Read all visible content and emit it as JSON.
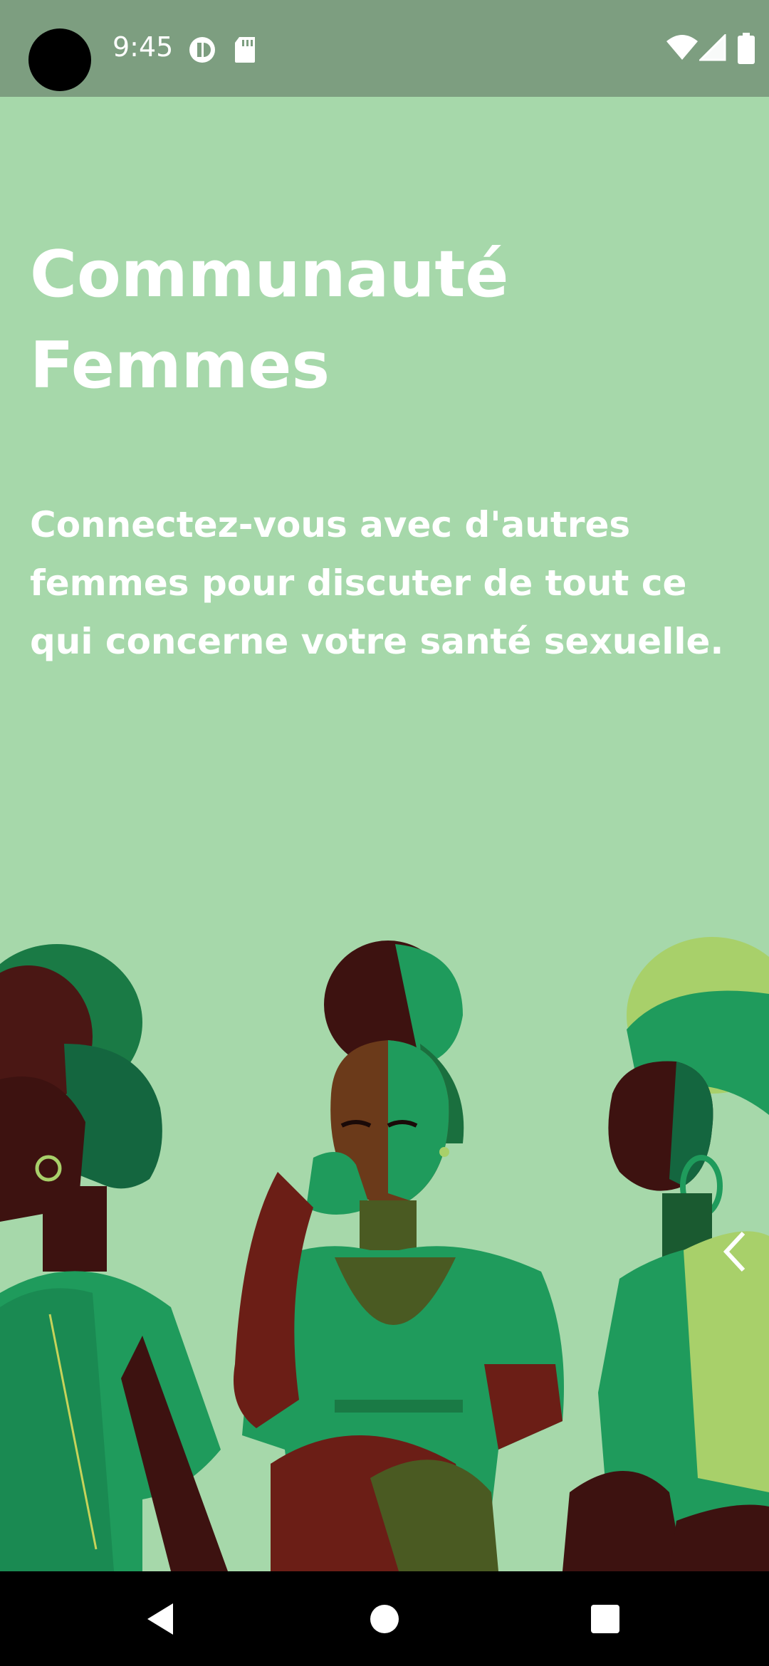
{
  "status_bar": {
    "time": "9:45",
    "icons": [
      "camera-cutout",
      "data-saver-icon",
      "sd-card-icon",
      "wifi-icon",
      "signal-icon",
      "battery-icon"
    ]
  },
  "onboarding": {
    "title": "Communauté Femmes",
    "subtitle": "Connectez-vous avec d'autres femmes pour discuter de tout ce qui concerne votre santé sexuelle.",
    "illustration": "three-women-talking-illustration",
    "back_icon": "chevron-left-icon"
  },
  "nav_bar": {
    "buttons": [
      "back-triangle-icon",
      "home-circle-icon",
      "recents-square-icon"
    ]
  },
  "colors": {
    "background": "#a6d8aa",
    "status_bar": "#7d9e80",
    "text": "#ffffff",
    "green_dark": "#14663f",
    "green_mid": "#1f9b5c",
    "green_light": "#a8d06a",
    "skin_dark": "#3d1210",
    "skin_red": "#6b1e16"
  }
}
